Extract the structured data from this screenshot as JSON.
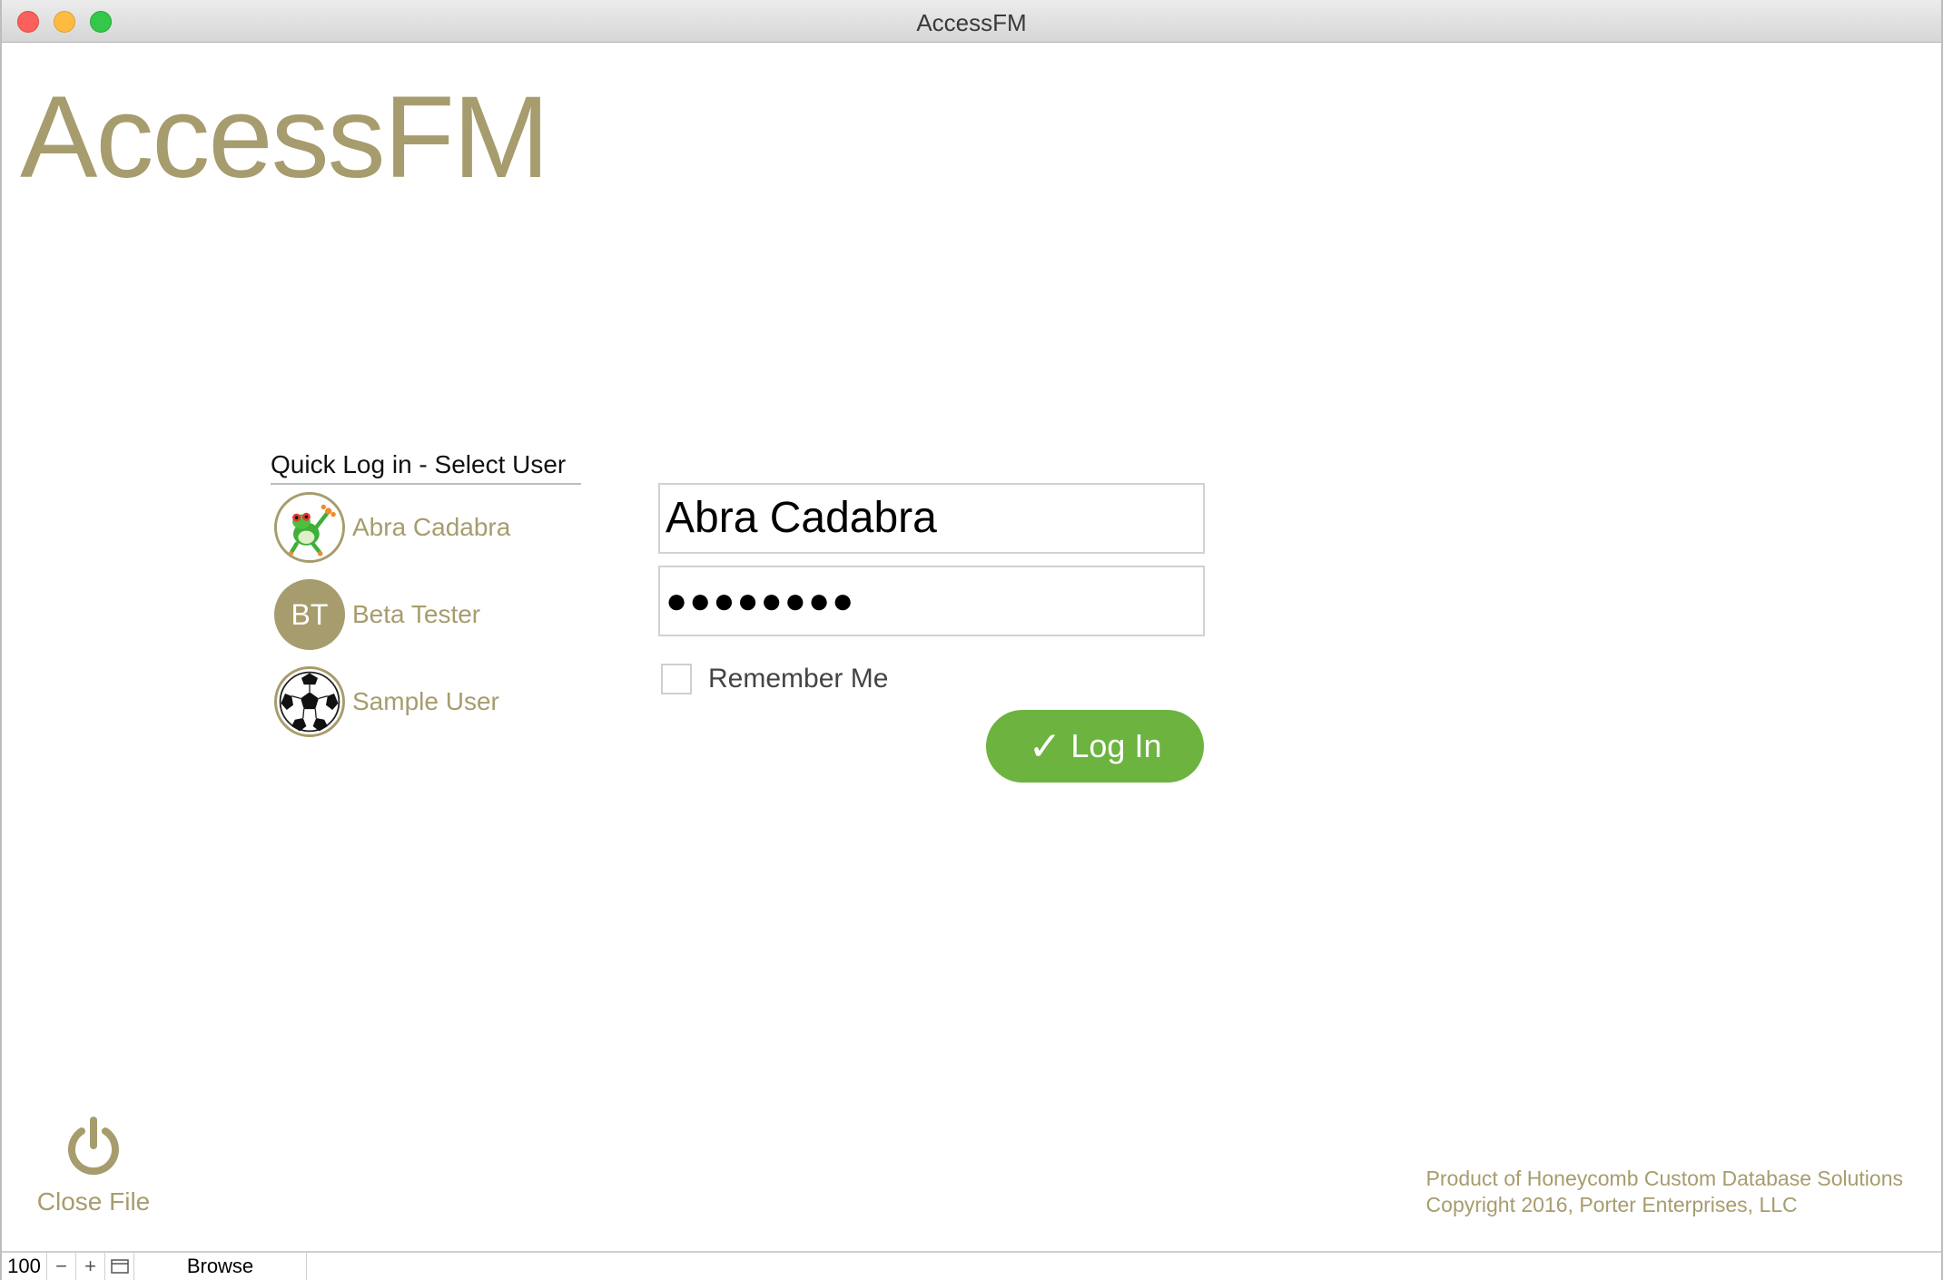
{
  "window": {
    "title": "AccessFM"
  },
  "app": {
    "logo_text": "AccessFM"
  },
  "quick_login": {
    "title": "Quick Log in - Select User",
    "users": [
      {
        "name": "Abra Cadabra",
        "avatar_icon": "frog-icon"
      },
      {
        "name": "Beta Tester",
        "initials": "BT"
      },
      {
        "name": "Sample User",
        "avatar_icon": "soccer-ball-icon"
      }
    ]
  },
  "login_form": {
    "username_value": "Abra Cadabra",
    "password_value": "●●●●●●●●",
    "remember_label": "Remember Me",
    "remember_checked": false,
    "login_label": "Log In",
    "login_icon": "✓"
  },
  "close_file": {
    "label": "Close File",
    "icon": "power-icon"
  },
  "footer": {
    "line1": "Product of Honeycomb Custom Database Solutions",
    "line2": "Copyright 2016, Porter Enterprises, LLC"
  },
  "statusbar": {
    "zoom": "100",
    "zoom_out": "−",
    "zoom_in": "+",
    "mode": "Browse"
  },
  "colors": {
    "accent": "#a79c6d",
    "button": "#6cb33f"
  }
}
